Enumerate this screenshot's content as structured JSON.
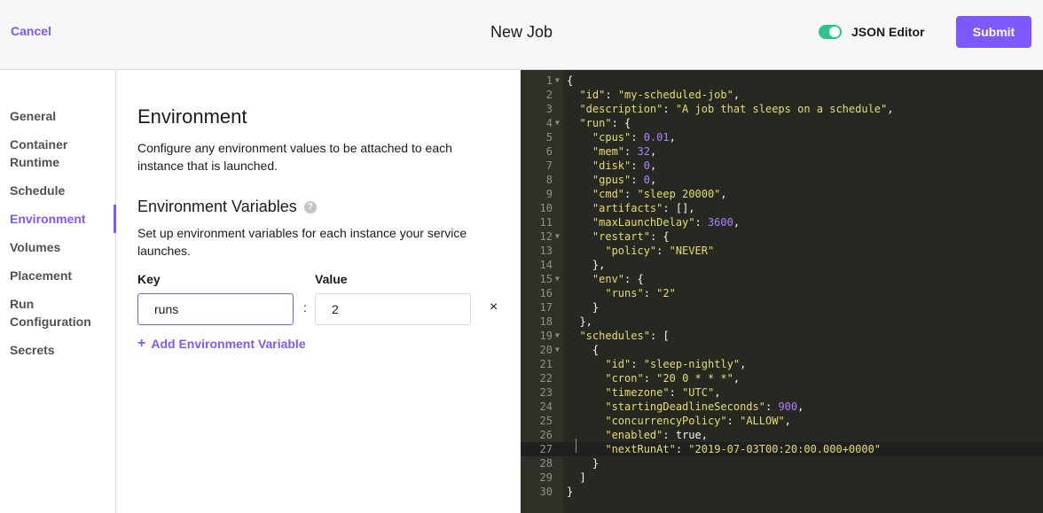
{
  "header": {
    "cancel_label": "Cancel",
    "title": "New Job",
    "json_editor_label": "JSON Editor",
    "submit_label": "Submit"
  },
  "sidebar": {
    "items": [
      {
        "label": "General"
      },
      {
        "label": "Container Runtime"
      },
      {
        "label": "Schedule"
      },
      {
        "label": "Environment"
      },
      {
        "label": "Volumes"
      },
      {
        "label": "Placement"
      },
      {
        "label": "Run Configuration"
      },
      {
        "label": "Secrets"
      }
    ],
    "active_index": 3
  },
  "form": {
    "title": "Environment",
    "description": "Configure any environment values to be attached to each instance that is launched.",
    "env_vars_title": "Environment Variables",
    "env_vars_description": "Set up environment variables for each instance your service launches.",
    "key_label": "Key",
    "value_label": "Value",
    "key_value": "runs",
    "value_value": "2",
    "colon": ":",
    "remove_glyph": "×",
    "add_label": "Add Environment Variable"
  },
  "editor": {
    "lines": [
      "{",
      "  \"id\": \"my-scheduled-job\",",
      "  \"description\": \"A job that sleeps on a schedule\",",
      "  \"run\": {",
      "    \"cpus\": 0.01,",
      "    \"mem\": 32,",
      "    \"disk\": 0,",
      "    \"gpus\": 0,",
      "    \"cmd\": \"sleep 20000\",",
      "    \"artifacts\": [],",
      "    \"maxLaunchDelay\": 3600,",
      "    \"restart\": {",
      "      \"policy\": \"NEVER\"",
      "    },",
      "    \"env\": {",
      "      \"runs\": \"2\"",
      "    }",
      "  },",
      "  \"schedules\": [",
      "    {",
      "      \"id\": \"sleep-nightly\",",
      "      \"cron\": \"20 0 * * *\",",
      "      \"timezone\": \"UTC\",",
      "      \"startingDeadlineSeconds\": 900,",
      "      \"concurrencyPolicy\": \"ALLOW\",",
      "      \"enabled\": true,",
      "      \"nextRunAt\": \"2019-07-03T00:20:00.000+0000\"",
      "    }",
      "  ]",
      "}"
    ],
    "fold_lines": [
      1,
      4,
      12,
      15,
      19,
      20
    ],
    "active_line": 27
  },
  "colors": {
    "accent": "#7d58ff",
    "toggle_on": "#2ec48f",
    "editor_bg": "#272822"
  },
  "icons": {
    "help": "question-circle-icon",
    "remove": "close-icon",
    "add": "plus-icon",
    "fold": "caret-down-icon"
  }
}
